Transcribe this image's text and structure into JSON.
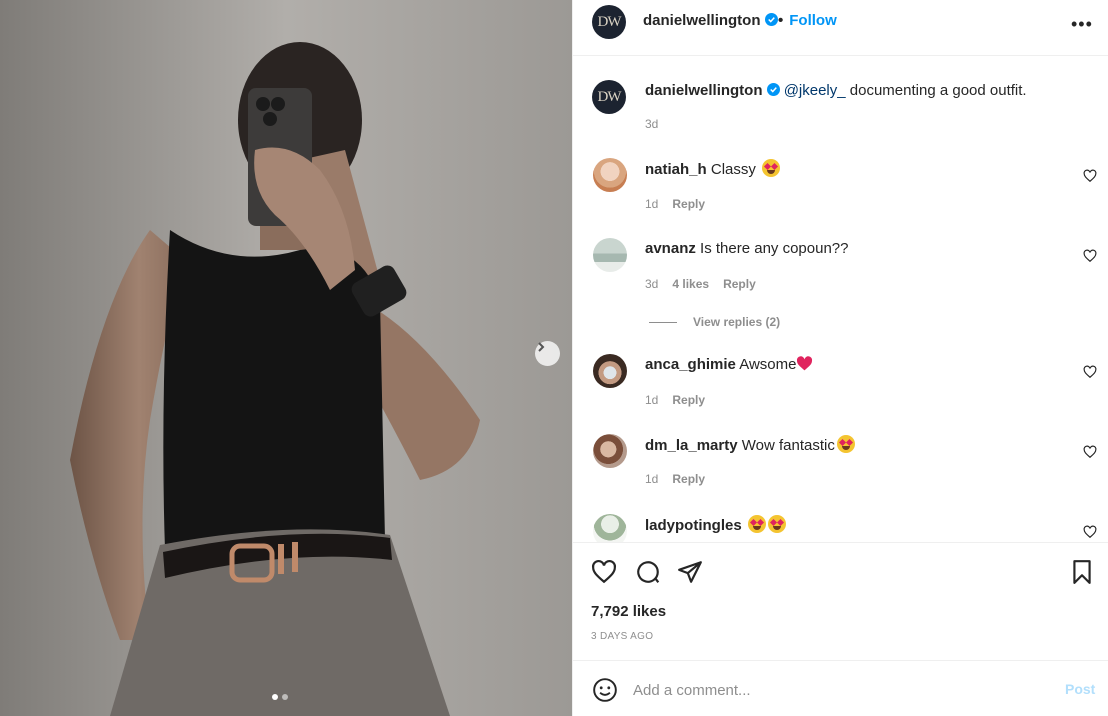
{
  "post": {
    "username": "danielwellington",
    "logo_text": "DW",
    "follow_label": "Follow",
    "dot": "•",
    "more_label": "•••",
    "caption_mention": "@jkeely_",
    "caption_text": " documenting a good outfit.",
    "caption_time": "3d"
  },
  "carousel": {
    "total_slides": 2,
    "active_slide": 1
  },
  "comments": [
    {
      "user": "natiah_h",
      "text": "Classy ",
      "time": "1d",
      "likes": "",
      "reply_label": "Reply"
    },
    {
      "user": "avnanz",
      "text": "Is there any copoun??",
      "time": "3d",
      "likes": "4 likes",
      "reply_label": "Reply",
      "view_replies": "View replies (2)"
    },
    {
      "user": "anca_ghimie",
      "text": "Awsome",
      "time": "1d",
      "likes": "",
      "reply_label": "Reply"
    },
    {
      "user": "dm_la_marty",
      "text": "Wow fantastic",
      "time": "1d",
      "likes": "",
      "reply_label": "Reply"
    },
    {
      "user": "ladypotingles",
      "text": "",
      "time": "",
      "likes": "",
      "reply_label": ""
    }
  ],
  "stats": {
    "likes": "7,792 likes",
    "date": "3 DAYS AGO"
  },
  "composer": {
    "placeholder": "Add a comment...",
    "post_label": "Post"
  },
  "colors": {
    "accent": "#0095f6",
    "verified": "#0095f6",
    "post_disabled": "#b2dffc",
    "text": "#262626",
    "muted": "#8e8e8e"
  }
}
